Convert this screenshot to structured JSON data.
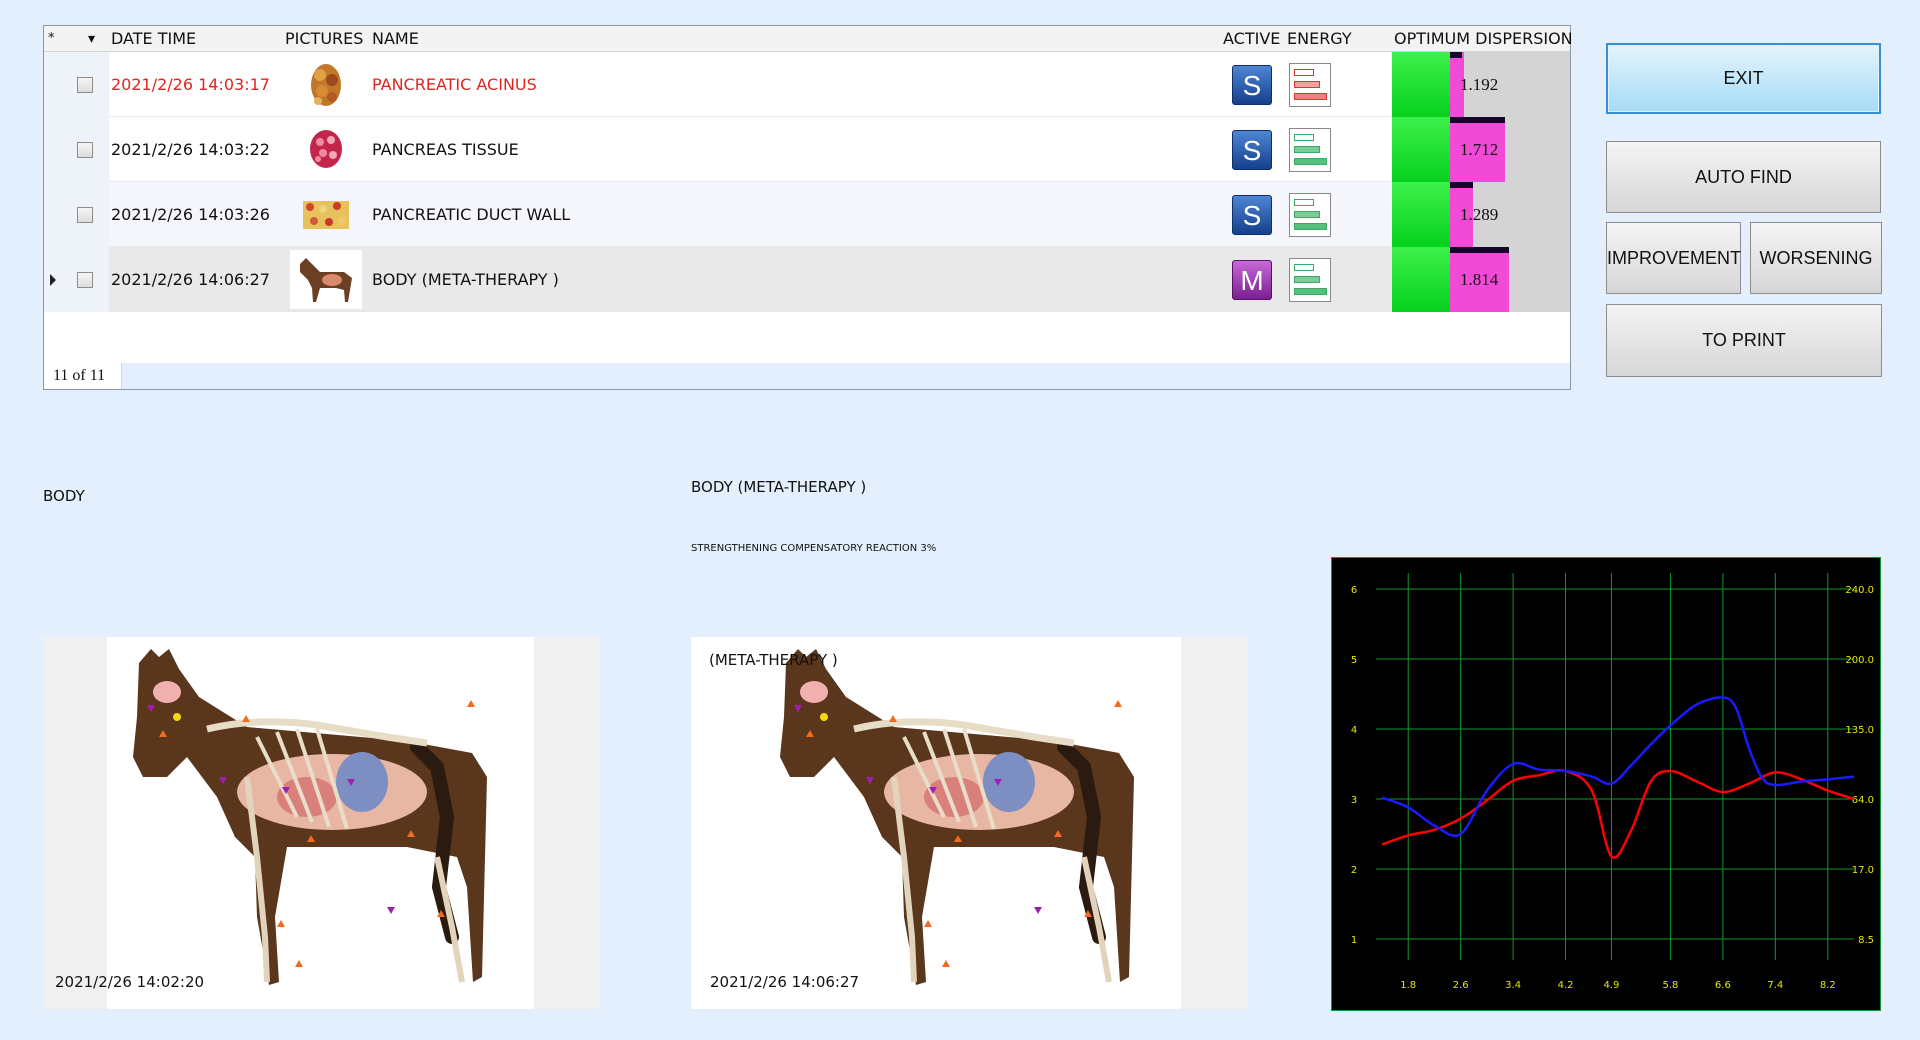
{
  "table": {
    "header": {
      "star": "*",
      "sort": "▾",
      "date_time": "DATE TIME",
      "pictures": "PICTURES",
      "name": "NAME",
      "active": "ACTIVE",
      "energy": "ENERGY",
      "dispersion": "OPTIMUM DISPERSION"
    },
    "rows": [
      {
        "date": "2021/2/26 14:03:17",
        "name": "PANCREATIC ACINUS",
        "active": "S",
        "value": "1.192",
        "fill": 0.08
      },
      {
        "date": "2021/2/26 14:03:22",
        "name": "PANCREAS  TISSUE",
        "active": "S",
        "value": "1.712",
        "fill": 0.31
      },
      {
        "date": "2021/2/26 14:03:26",
        "name": "PANCREATIC DUCT WALL",
        "active": "S",
        "value": "1.289",
        "fill": 0.13
      },
      {
        "date": "2021/2/26 14:06:27",
        "name": "BODY (META-THERAPY )",
        "active": "M",
        "value": "1.814",
        "fill": 0.33
      }
    ],
    "footer": "11 of 11"
  },
  "buttons": {
    "exit": "EXIT",
    "auto_find": "AUTO FIND",
    "improvement": "IMPROVEMENT",
    "worsening": "WORSENING",
    "print": "TO PRINT"
  },
  "left_panel": {
    "title": "BODY",
    "timestamp": "2021/2/26 14:02:20"
  },
  "middle_panel": {
    "title": "BODY (META-THERAPY )",
    "subtitle": "STRENGTHENING COMPENSATORY REACTION 3%",
    "image_title": "(META-THERAPY )",
    "timestamp": "2021/2/26 14:06:27"
  },
  "colors": {
    "red_text": "#e0241f",
    "green_bar": "#06d11d",
    "magenta_bar": "#f04ad6",
    "chart_bg": "#000000",
    "grid_line": "#0f9a2c",
    "series_red": "#ff0000",
    "series_blue": "#1a1aff",
    "tick_yellow": "#e6e600"
  },
  "chart_data": {
    "type": "line",
    "x_ticks": [
      "1.8",
      "2.6",
      "3.4",
      "4.2",
      "4.9",
      "5.8",
      "6.6",
      "7.4",
      "8.2"
    ],
    "y_left_ticks": [
      "6",
      "5",
      "4",
      "3",
      "2",
      "1"
    ],
    "y_right_ticks": [
      "240.0",
      "200.0",
      "135.0",
      "64.0",
      "17.0",
      "8.5"
    ],
    "ylim": [
      1,
      6
    ],
    "grid": true,
    "series": [
      {
        "color": "red",
        "x": [
          1.4,
          1.8,
          2.2,
          2.6,
          3.0,
          3.4,
          3.8,
          4.2,
          4.6,
          4.9,
          5.2,
          5.5,
          5.8,
          6.2,
          6.6,
          7.0,
          7.4,
          7.8,
          8.2,
          8.6
        ],
        "y": [
          2.35,
          2.48,
          2.56,
          2.72,
          2.98,
          3.26,
          3.34,
          3.4,
          3.12,
          2.18,
          2.55,
          3.25,
          3.4,
          3.25,
          3.1,
          3.22,
          3.38,
          3.28,
          3.12,
          3.0
        ]
      },
      {
        "color": "blue",
        "x": [
          1.4,
          1.8,
          2.2,
          2.6,
          3.0,
          3.4,
          3.8,
          4.2,
          4.6,
          4.9,
          5.2,
          5.5,
          5.8,
          6.2,
          6.6,
          6.8,
          7.0,
          7.2,
          7.4,
          7.8,
          8.2,
          8.6
        ],
        "y": [
          3.02,
          2.88,
          2.62,
          2.5,
          3.12,
          3.5,
          3.42,
          3.4,
          3.32,
          3.22,
          3.48,
          3.78,
          4.05,
          4.35,
          4.45,
          4.3,
          3.72,
          3.3,
          3.2,
          3.25,
          3.28,
          3.32
        ]
      }
    ]
  }
}
